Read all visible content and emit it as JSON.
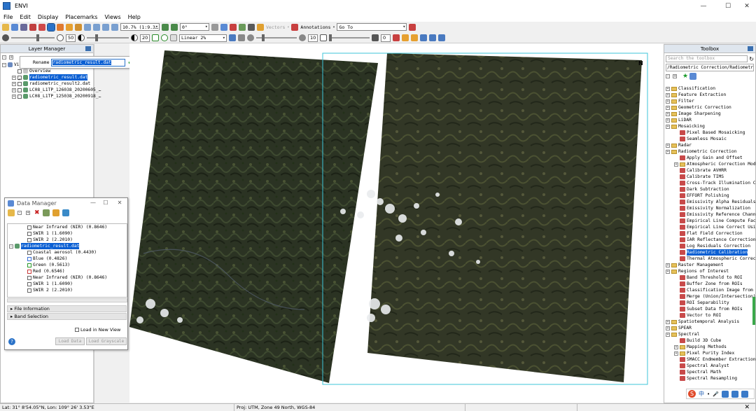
{
  "window": {
    "title": "ENVI",
    "min": "—",
    "max": "☐",
    "close": "✕"
  },
  "menu": [
    "File",
    "Edit",
    "Display",
    "Placemarks",
    "Views",
    "Help"
  ],
  "toolbar1": {
    "zoom_value": "10.7% (1:9.3…",
    "rotation_value": "0°",
    "vectors_label": "Vectors",
    "annotations_label": "Annotations",
    "goto_placeholder": "Go To"
  },
  "toolbar2": {
    "brightness_value": "50",
    "contrast_value": "20",
    "stretch_value": "Linear 2%",
    "sharpen_value": "10",
    "transparency_value": "0"
  },
  "layer_manager": {
    "title": "Layer Manager",
    "view_label": "View",
    "rename_label": "Rename",
    "rename_value": "radiometric_result.dat",
    "items": [
      {
        "label": "Overview",
        "checked": false,
        "selected": false
      },
      {
        "label": "radiometric_result.dat",
        "checked": true,
        "selected": true
      },
      {
        "label": "radiometric_result2.dat",
        "checked": true,
        "selected": false
      },
      {
        "label": "LC08_L1TP_126038_20200605_…",
        "checked": true,
        "selected": false
      },
      {
        "label": "LC08_L1TP_125038_20200918_…",
        "checked": true,
        "selected": false
      }
    ]
  },
  "data_manager": {
    "title": "Data Manager",
    "bands_top": [
      "Near Infrared (NIR) (0.8646)",
      "SWIR 1 (1.6090)",
      "SWIR 2 (2.2010)"
    ],
    "dataset": "radiometric_result.dat",
    "bands": [
      "Coastal aerosol (0.4430)",
      "Blue (0.4826)",
      "Green (0.5613)",
      "Red (0.6546)",
      "Near Infrared (NIR) (0.8646)",
      "SWIR 1 (1.6090)",
      "SWIR 2 (2.2010)"
    ],
    "section_file_info": "File Information",
    "section_band_select": "Band Selection",
    "load_new_view": "Load in New View",
    "load_data": "Load Data",
    "load_grayscale": "Load Grayscale",
    "help": "?"
  },
  "map": {
    "north_label": "N"
  },
  "toolbox": {
    "title": "Toolbox",
    "search_placeholder": "Search the toolbox",
    "path": "/Radiometric Correction/Radiometric Ca…",
    "tree": [
      {
        "label": "Classification",
        "type": "folder",
        "indent": 0,
        "sel": false
      },
      {
        "label": "Feature Extraction",
        "type": "folder",
        "indent": 0,
        "sel": false
      },
      {
        "label": "Filter",
        "type": "folder",
        "indent": 0,
        "sel": false
      },
      {
        "label": "Geometric Correction",
        "type": "folder",
        "indent": 0,
        "sel": false
      },
      {
        "label": "Image Sharpening",
        "type": "folder",
        "indent": 0,
        "sel": false
      },
      {
        "label": "LiDAR",
        "type": "folder",
        "indent": 0,
        "sel": false
      },
      {
        "label": "Mosaicking",
        "type": "folder",
        "indent": 0,
        "sel": false
      },
      {
        "label": "Pixel Based Mosaicking",
        "type": "tool",
        "indent": 1,
        "sel": false
      },
      {
        "label": "Seamless Mosaic",
        "type": "tool",
        "indent": 1,
        "sel": false
      },
      {
        "label": "Radar",
        "type": "folder",
        "indent": 0,
        "sel": false
      },
      {
        "label": "Radiometric Correction",
        "type": "folder",
        "indent": 0,
        "sel": false
      },
      {
        "label": "Apply Gain and Offset",
        "type": "tool",
        "indent": 1,
        "sel": false
      },
      {
        "label": "Atmospheric Correction Modul…",
        "type": "folder",
        "indent": 1,
        "sel": false
      },
      {
        "label": "Calibrate AVHRR",
        "type": "tool",
        "indent": 1,
        "sel": false
      },
      {
        "label": "Calibrate TIMS",
        "type": "tool",
        "indent": 1,
        "sel": false
      },
      {
        "label": "Cross-Track Illumination Cor…",
        "type": "tool",
        "indent": 1,
        "sel": false
      },
      {
        "label": "Dark Subtraction",
        "type": "tool",
        "indent": 1,
        "sel": false
      },
      {
        "label": "EFFORT Polishing",
        "type": "tool",
        "indent": 1,
        "sel": false
      },
      {
        "label": "Emissivity Alpha Residuals",
        "type": "tool",
        "indent": 1,
        "sel": false
      },
      {
        "label": "Emissivity Normalization",
        "type": "tool",
        "indent": 1,
        "sel": false
      },
      {
        "label": "Emissivity Reference Channel",
        "type": "tool",
        "indent": 1,
        "sel": false
      },
      {
        "label": "Empirical Line Compute Facto…",
        "type": "tool",
        "indent": 1,
        "sel": false
      },
      {
        "label": "Empirical Line Correct Using…",
        "type": "tool",
        "indent": 1,
        "sel": false
      },
      {
        "label": "Flat Field Correction",
        "type": "tool",
        "indent": 1,
        "sel": false
      },
      {
        "label": "IAR Reflectance Correction",
        "type": "tool",
        "indent": 1,
        "sel": false
      },
      {
        "label": "Log Residuals Correction",
        "type": "tool",
        "indent": 1,
        "sel": false
      },
      {
        "label": "Radiometric Calibration",
        "type": "tool",
        "indent": 1,
        "sel": true
      },
      {
        "label": "Thermal Atmospheric Correcti…",
        "type": "tool",
        "indent": 1,
        "sel": false
      },
      {
        "label": "Raster Management",
        "type": "folder",
        "indent": 0,
        "sel": false
      },
      {
        "label": "Regions of Interest",
        "type": "folder",
        "indent": 0,
        "sel": false
      },
      {
        "label": "Band Threshold to ROI",
        "type": "tool",
        "indent": 1,
        "sel": false
      },
      {
        "label": "Buffer Zone from ROIs",
        "type": "tool",
        "indent": 1,
        "sel": false
      },
      {
        "label": "Classification Image from RO…",
        "type": "tool",
        "indent": 1,
        "sel": false
      },
      {
        "label": "Merge (Union/Intersection) R…",
        "type": "tool",
        "indent": 1,
        "sel": false
      },
      {
        "label": "ROI Separability",
        "type": "tool",
        "indent": 1,
        "sel": false
      },
      {
        "label": "Subset Data from ROIs",
        "type": "tool",
        "indent": 1,
        "sel": false
      },
      {
        "label": "Vector to ROI",
        "type": "tool",
        "indent": 1,
        "sel": false
      },
      {
        "label": "Spatiotemporal Analysis",
        "type": "folder",
        "indent": 0,
        "sel": false
      },
      {
        "label": "SPEAR",
        "type": "folder",
        "indent": 0,
        "sel": false
      },
      {
        "label": "Spectral",
        "type": "folder",
        "indent": 0,
        "sel": false
      },
      {
        "label": "Build 3D Cube",
        "type": "tool",
        "indent": 1,
        "sel": false
      },
      {
        "label": "Mapping Methods",
        "type": "folder",
        "indent": 1,
        "sel": false
      },
      {
        "label": "Pixel Purity Index",
        "type": "folder",
        "indent": 1,
        "sel": false
      },
      {
        "label": "SMACC Endmember Extraction",
        "type": "tool",
        "indent": 1,
        "sel": false
      },
      {
        "label": "Spectral Analyst",
        "type": "tool",
        "indent": 1,
        "sel": false
      },
      {
        "label": "Spectral Math",
        "type": "tool",
        "indent": 1,
        "sel": false
      },
      {
        "label": "Spectral Resampling",
        "type": "tool",
        "indent": 1,
        "sel": false
      }
    ]
  },
  "ime": {
    "label": "中"
  },
  "status": {
    "coords": "Lat: 31° 8'54.05\"N, Lon: 109° 26' 3.53\"E",
    "projection": "Proj: UTM, Zone 49 North, WGS-84"
  },
  "colors": {
    "selection": "#0a5fd3",
    "accent": "#2a72c8",
    "boundary": "#3cc4d8"
  }
}
